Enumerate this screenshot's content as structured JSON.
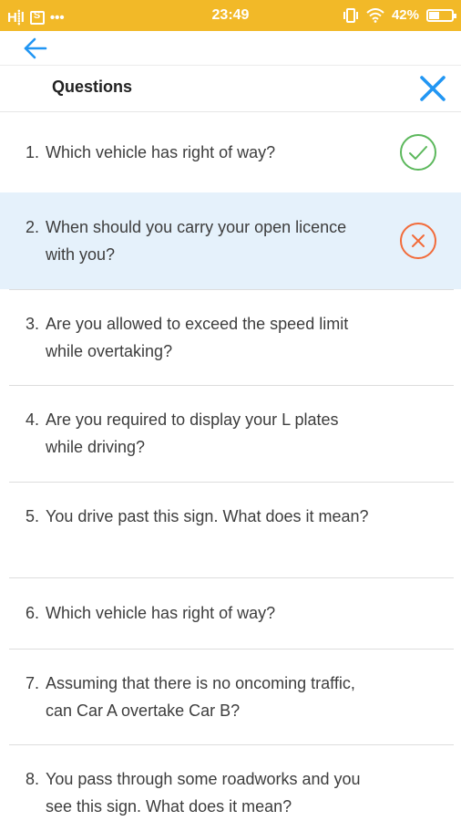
{
  "status_bar": {
    "signal": "H⸽l",
    "time": "23:49",
    "battery": "42%",
    "battery_level": 0.42,
    "more": "•••"
  },
  "header": {
    "title": "Questions"
  },
  "colors": {
    "status_bar": "#f2b928",
    "accent_blue": "#2196f3",
    "correct": "#5cb85c",
    "incorrect": "#f26b3a",
    "highlight": "#e5f1fb"
  },
  "questions": [
    {
      "number": "1.",
      "text": "Which vehicle has right of way?",
      "status": "correct"
    },
    {
      "number": "2.",
      "text": "When should you carry your open licence with you?",
      "status": "incorrect"
    },
    {
      "number": "3.",
      "text": "Are you allowed to exceed the speed limit while overtaking?",
      "status": ""
    },
    {
      "number": "4.",
      "text": "Are you required to display your L plates while driving?",
      "status": ""
    },
    {
      "number": "5.",
      "text": "You drive past this sign. What does it mean?",
      "status": ""
    },
    {
      "number": "6.",
      "text": "Which vehicle has right of way?",
      "status": ""
    },
    {
      "number": "7.",
      "text": "Assuming that there is no oncoming traffic, can Car A overtake Car B?",
      "status": ""
    },
    {
      "number": "8.",
      "text": "You pass through some roadworks and you see this sign. What does it mean?",
      "status": ""
    }
  ]
}
